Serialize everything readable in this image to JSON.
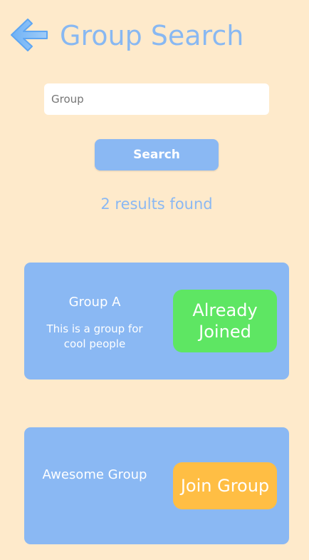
{
  "header": {
    "title": "Group Search",
    "back_icon": "back-arrow-icon"
  },
  "search": {
    "value": "",
    "placeholder": "Group",
    "button_label": "Search"
  },
  "results": {
    "count_text": "2 results found",
    "groups": [
      {
        "name": "Group A",
        "description": "This is a group for cool people",
        "action_label": "Already Joined",
        "action_color": "#5EE663"
      },
      {
        "name": "Awesome Group",
        "description": "",
        "action_label": "Join Group",
        "action_color": "#FFBE44"
      }
    ]
  },
  "colors": {
    "background": "#FEEACB",
    "accent": "#8AB8F3",
    "card": "#8AB8F3",
    "joined": "#5EE663",
    "join": "#FFBE44"
  }
}
